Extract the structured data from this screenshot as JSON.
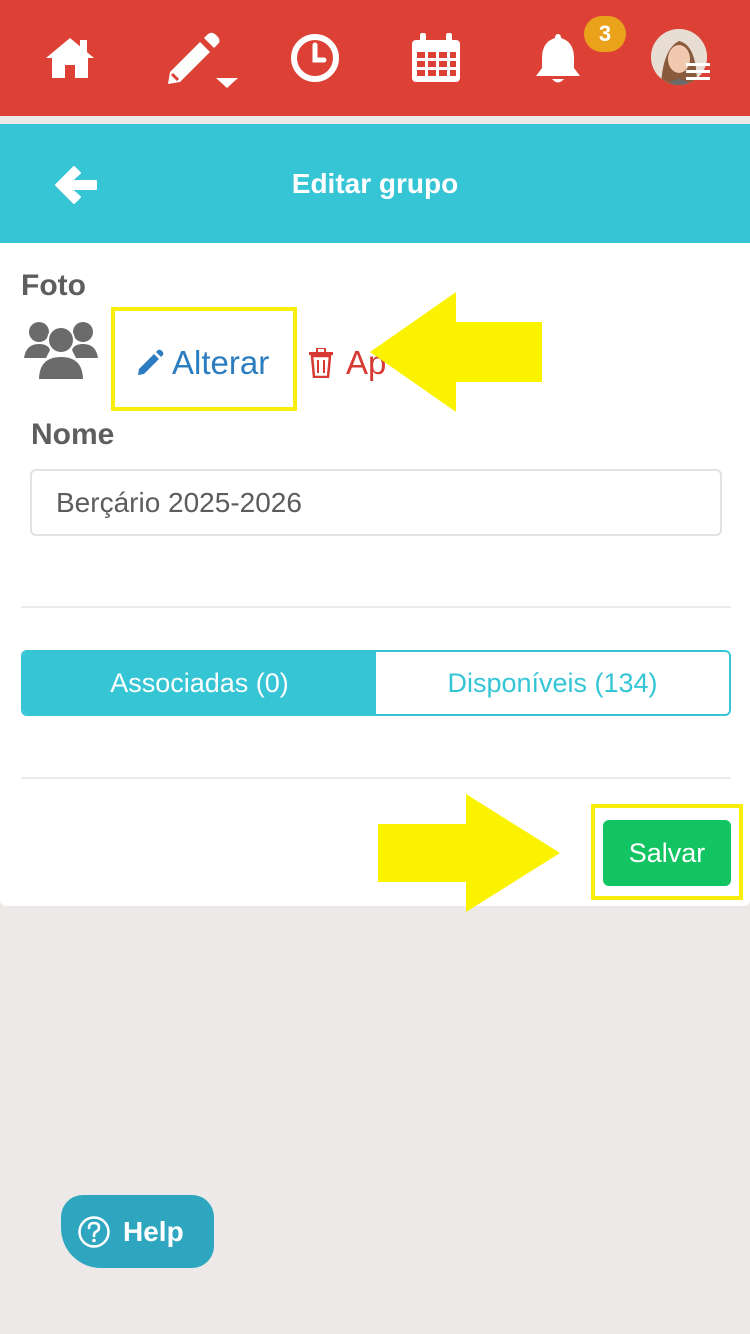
{
  "topbar": {
    "icons": [
      "home-icon",
      "edit-icon",
      "clock-icon",
      "calendar-icon",
      "bell-icon"
    ],
    "notification_count": "3",
    "background": "#dd4135"
  },
  "header": {
    "title": "Editar grupo",
    "back_icon": "arrow-left-icon",
    "background": "#35c5d5"
  },
  "foto": {
    "label": "Foto",
    "alterar_label": "Alterar",
    "apagar_label": "Ap"
  },
  "nome": {
    "label": "Nome",
    "value": "Berçário 2025-2026"
  },
  "tabs": [
    {
      "label": "Associadas (0)",
      "active": true
    },
    {
      "label": "Disponíveis (134)",
      "active": false
    }
  ],
  "actions": {
    "save_label": "Salvar",
    "save_color": "#13c463"
  },
  "help": {
    "label": "Help"
  },
  "annotation_color": "#f7ee0a"
}
